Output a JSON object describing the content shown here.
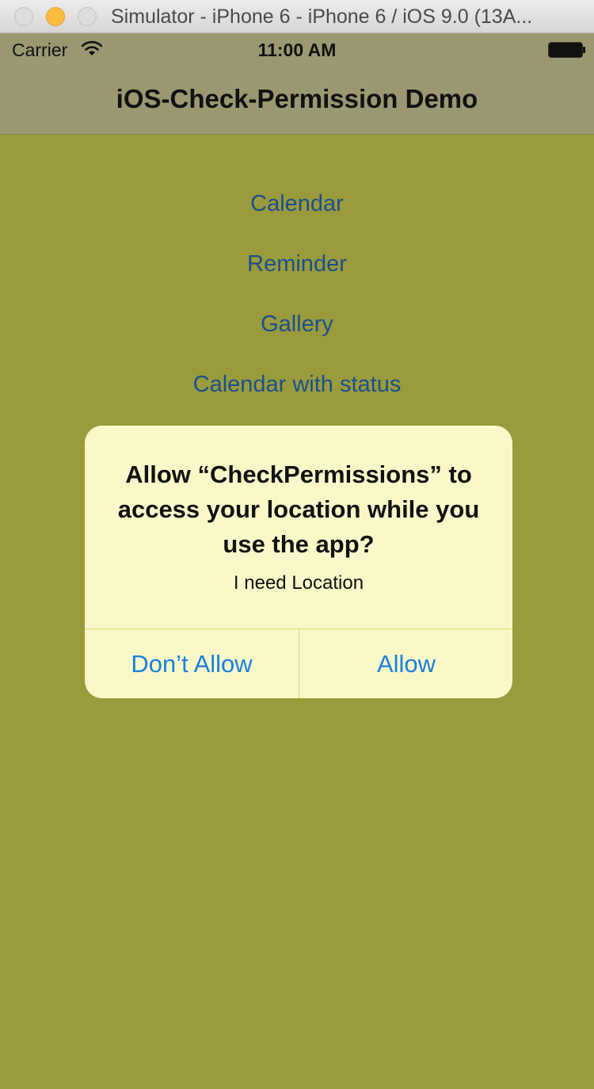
{
  "window": {
    "title": "Simulator - iPhone 6 - iPhone 6 / iOS 9.0 (13A..."
  },
  "status_bar": {
    "carrier": "Carrier",
    "time": "11:00 AM"
  },
  "nav": {
    "title": "iOS-Check-Permission Demo"
  },
  "menu": {
    "items": [
      {
        "label": "Calendar"
      },
      {
        "label": "Reminder"
      },
      {
        "label": "Gallery"
      },
      {
        "label": "Calendar with status"
      }
    ]
  },
  "alert": {
    "title": "Allow “CheckPermissions” to access your location while you use the app?",
    "message": "I need Location",
    "buttons": {
      "cancel": "Don’t Allow",
      "confirm": "Allow"
    }
  },
  "colors": {
    "content_bg": "#999b3c",
    "nav_bg": "#9a9870",
    "alert_bg": "#f9f8c8",
    "link": "#1d4e8c",
    "alert_button": "#1a7fe0"
  },
  "icons": [
    "close-window-icon",
    "minimize-window-icon",
    "zoom-window-icon",
    "wifi-icon",
    "battery-icon"
  ]
}
